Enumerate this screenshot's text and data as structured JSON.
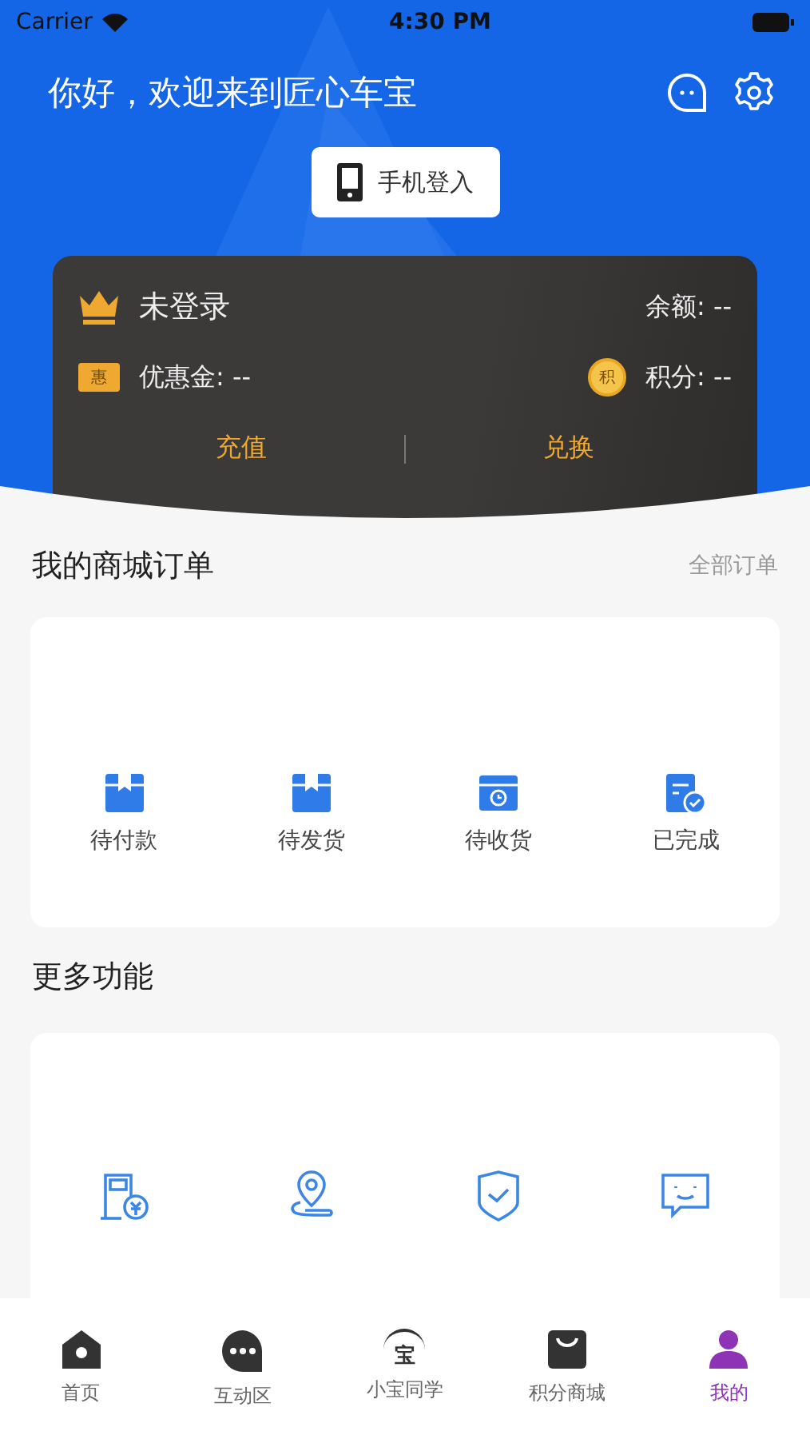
{
  "status_bar": {
    "carrier": "Carrier",
    "time": "4:30 PM"
  },
  "header": {
    "greeting": "你好，欢迎来到匠心车宝",
    "login_button": "手机登入"
  },
  "member_card": {
    "status": "未登录",
    "balance": "余额: --",
    "coupon_icon": "惠",
    "coupon": "优惠金: --",
    "points_icon": "积",
    "points": "积分: --",
    "actions": [
      "充值",
      "兑换"
    ]
  },
  "orders": {
    "title": "我的商城订单",
    "link": "全部订单",
    "items": [
      {
        "kind": "box",
        "label": "待付款"
      },
      {
        "kind": "box",
        "label": "待发货"
      },
      {
        "kind": "delivery",
        "label": "待收货"
      },
      {
        "kind": "done",
        "label": "已完成"
      }
    ]
  },
  "more": {
    "title": "更多功能",
    "items": [
      {
        "kind": "station"
      },
      {
        "kind": "location"
      },
      {
        "kind": "shield"
      },
      {
        "kind": "feedback"
      }
    ]
  },
  "tab_bar": [
    {
      "kind": "home",
      "label": "首页",
      "selected": false
    },
    {
      "kind": "chat",
      "label": "互动区",
      "selected": false
    },
    {
      "kind": "assistant",
      "label": "小宝同学",
      "icon_text": "宝",
      "selected": false
    },
    {
      "kind": "shop",
      "label": "积分商城",
      "selected": false
    },
    {
      "kind": "profile",
      "label": "我的",
      "selected": true
    }
  ]
}
